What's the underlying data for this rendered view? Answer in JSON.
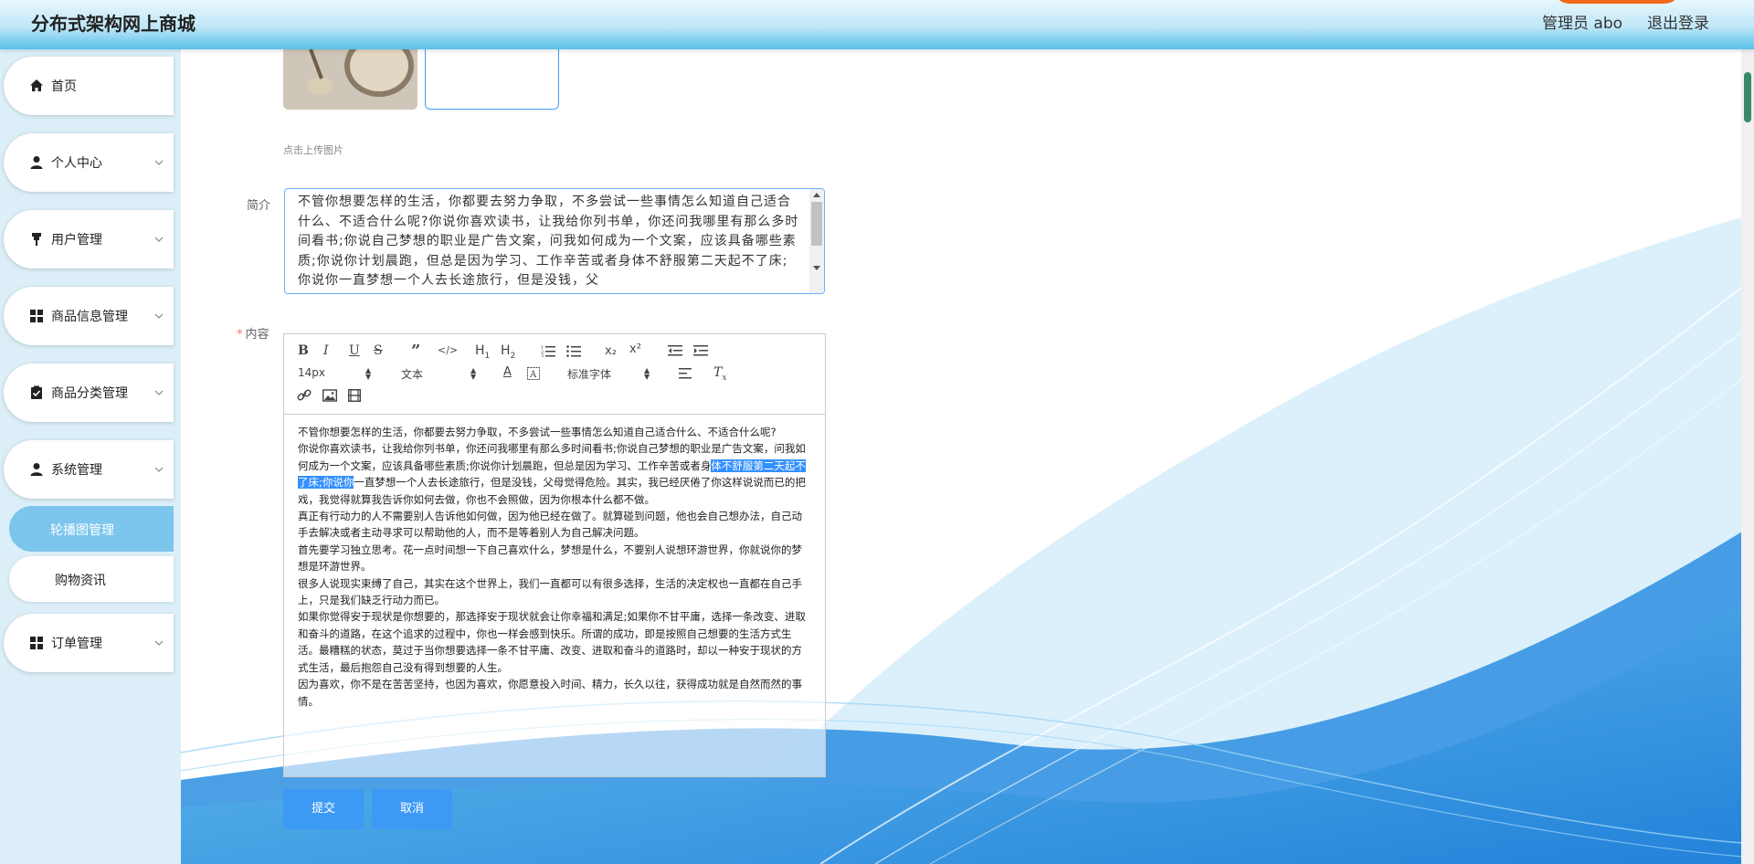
{
  "header": {
    "brand": "分布式架构网上商城",
    "admin_label": "管理员 abo",
    "logout_label": "退出登录"
  },
  "sidebar": {
    "items": [
      {
        "label": "首页",
        "icon": "home-icon"
      },
      {
        "label": "个人中心",
        "icon": "user-icon"
      },
      {
        "label": "用户管理",
        "icon": "pin-icon"
      },
      {
        "label": "商品信息管理",
        "icon": "grid-icon"
      },
      {
        "label": "商品分类管理",
        "icon": "clipboard-check-icon"
      },
      {
        "label": "系统管理",
        "icon": "user-icon"
      },
      {
        "label": "订单管理",
        "icon": "grid-icon"
      }
    ],
    "sub_items": [
      {
        "label": "轮播图管理",
        "active": true
      },
      {
        "label": "购物资讯",
        "active": false
      }
    ]
  },
  "form": {
    "upload_tip": "点击上传图片",
    "intro_label": "简介",
    "intro_text": "不管你想要怎样的生活，你都要去努力争取，不多尝试一些事情怎么知道自己适合什么、不适合什么呢?你说你喜欢读书，让我给你列书单，你还问我哪里有那么多时间看书;你说自己梦想的职业是广告文案，问我如何成为一个文案，应该具备哪些素质;你说你计划晨跑，但总是因为学习、工作辛苦或者身体不舒服第二天起不了床;你说你一直梦想一个人去长途旅行，但是没钱，父",
    "content_label": "内容",
    "required_mark": "*",
    "toolbar": {
      "font_size": "14px",
      "block_type": "文本",
      "font_family": "标准字体",
      "sub_label": "x₂",
      "sup_label": "x²"
    },
    "content": {
      "p1": "不管你想要怎样的生活，你都要去努力争取，不多尝试一些事情怎么知道自己适合什么、不适合什么呢?",
      "p2_before": "你说你喜欢读书，让我给你列书单，你还问我哪里有那么多时间看书;你说自己梦想的职业是广告文案，问我如何成为一个文案，应该具备哪些素质;你说你计划晨跑，但总是因为学习、工作辛苦或者身",
      "p2_selected": "体不舒服第二天起不了床;你说你",
      "p2_after": "一直梦想一个人去长途旅行，但是没钱，父母觉得危险。其实，我已经厌倦了你这样说说而已的把戏，我觉得就算我告诉你如何去做，你也不会照做，因为你根本什么都不做。",
      "p3": "真正有行动力的人不需要别人告诉他如何做，因为他已经在做了。就算碰到问题，他也会自己想办法，自己动手去解决或者主动寻求可以帮助他的人，而不是等着别人为自己解决问题。",
      "p4": "首先要学习独立思考。花一点时间想一下自己喜欢什么，梦想是什么，不要别人说想环游世界，你就说你的梦想是环游世界。",
      "p5": "很多人说现实束缚了自己，其实在这个世界上，我们一直都可以有很多选择，生活的决定权也一直都在自己手上，只是我们缺乏行动力而已。",
      "p6": "如果你觉得安于现状是你想要的，那选择安于现状就会让你幸福和满足;如果你不甘平庸，选择一条改变、进取和奋斗的道路，在这个追求的过程中，你也一样会感到快乐。所谓的成功，即是按照自己想要的生活方式生活。最糟糕的状态，莫过于当你想要选择一条不甘平庸、改变、进取和奋斗的道路时，却以一种安于现状的方式生活，最后抱怨自己没有得到想要的人生。",
      "p7": "因为喜欢，你不是在苦苦坚持，也因为喜欢，你愿意投入时间、精力，长久以往，获得成功就是自然而然的事情。"
    },
    "submit_label": "提交",
    "cancel_label": "取消"
  },
  "colors": {
    "header_accent": "#59c1ea",
    "sidebar_bg": "#dceff9",
    "active_sub": "#7cc5ec",
    "primary_button": "#3c9af5"
  }
}
